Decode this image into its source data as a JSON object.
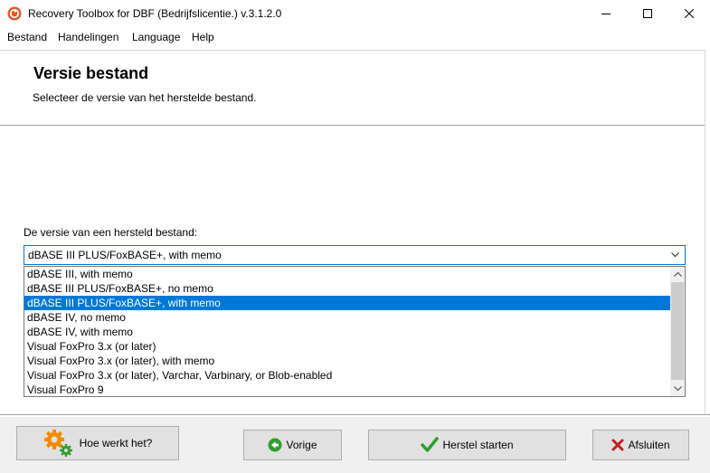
{
  "window": {
    "title": "Recovery Toolbox for DBF (Bedrijfslicentie.) v.3.1.2.0",
    "controls": [
      "minimize-icon",
      "maximize-icon",
      "close-icon"
    ]
  },
  "menu": {
    "items": [
      {
        "label": "Bestand"
      },
      {
        "label": "Handelingen"
      },
      {
        "label": "Language"
      },
      {
        "label": "Help"
      }
    ]
  },
  "header": {
    "title": "Versie bestand",
    "subtitle": "Selecteer de versie van het herstelde bestand."
  },
  "version_select": {
    "label": "De versie van een hersteld bestand:",
    "value": "dBASE III PLUS/FoxBASE+, with memo",
    "options": [
      {
        "label": "dBASE III, with memo"
      },
      {
        "label": "dBASE III PLUS/FoxBASE+, no memo"
      },
      {
        "label": "dBASE III PLUS/FoxBASE+, with memo",
        "selected": true
      },
      {
        "label": "dBASE IV, no memo"
      },
      {
        "label": "dBASE IV, with memo"
      },
      {
        "label": "Visual FoxPro 3.x (or later)"
      },
      {
        "label": "Visual FoxPro 3.x (or later), with memo"
      },
      {
        "label": "Visual FoxPro 3.x (or later), Varchar, Varbinary, or Blob-enabled"
      },
      {
        "label": "Visual FoxPro 9"
      }
    ],
    "highlight_color": "#0078d7"
  },
  "footer": {
    "help_label": "Hoe werkt het?",
    "back_label": "Vorige",
    "start_label": "Herstel starten",
    "close_label": "Afsluiten"
  },
  "icons": {
    "help": "gears-icon",
    "back": "arrow-left-icon",
    "start": "checkmark-icon",
    "close": "x-icon"
  },
  "colors": {
    "accent": "#0078d7",
    "check_green": "#2e9e2e",
    "close_red": "#c41e1e",
    "gear_orange": "#f08c00"
  }
}
